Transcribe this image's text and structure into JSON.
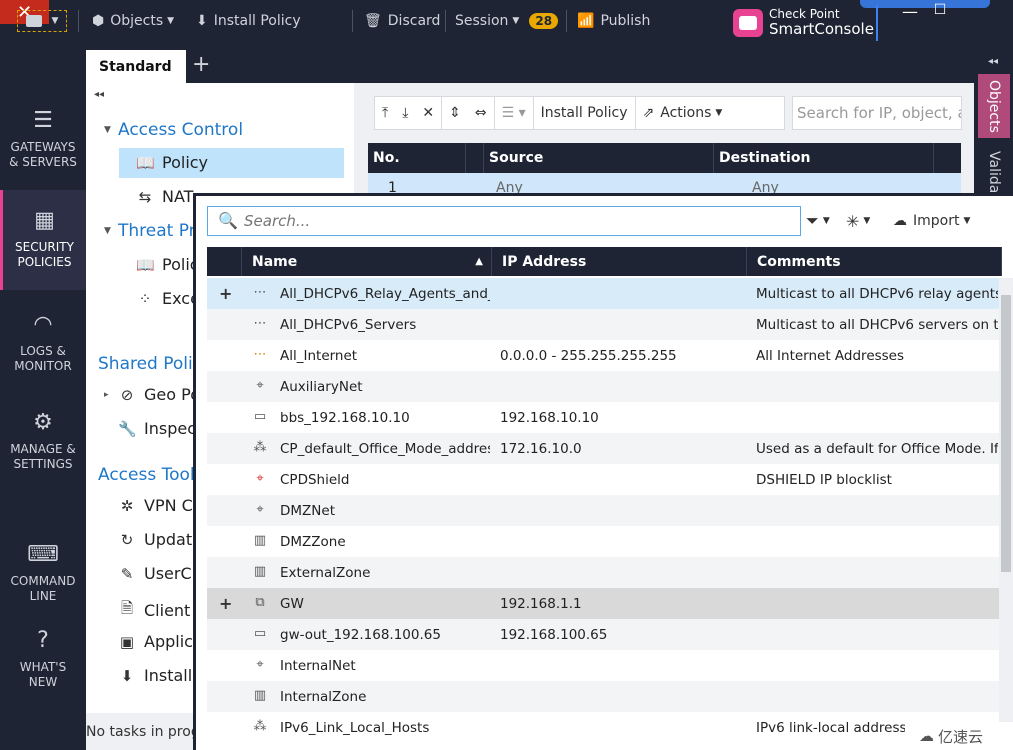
{
  "topbar": {
    "objects": "Objects",
    "install_policy": "Install Policy",
    "discard": "Discard",
    "session": "Session",
    "session_count": "28",
    "publish": "Publish",
    "brand_line1": "Check Point",
    "brand_line2": "SmartConsole"
  },
  "leftnav": [
    {
      "label1": "GATEWAYS",
      "label2": "& SERVERS"
    },
    {
      "label1": "SECURITY",
      "label2": "POLICIES"
    },
    {
      "label1": "LOGS &",
      "label2": "MONITOR"
    },
    {
      "label1": "MANAGE &",
      "label2": "SETTINGS"
    },
    {
      "label1": "COMMAND",
      "label2": "LINE"
    },
    {
      "label1": "WHAT'S",
      "label2": "NEW"
    }
  ],
  "tabs": {
    "standard": "Standard"
  },
  "tree": {
    "access_control": "Access Control",
    "policy": "Policy",
    "nat": "NAT",
    "threat_prevention": "Threat Pre",
    "threat_policy": "Polic",
    "exceptions": "Exce",
    "shared_policies": "Shared Polic",
    "geo_policy": "Geo Po",
    "inspection": "Inspec",
    "access_tools": "Access Tools",
    "vpn": "VPN Co",
    "updates": "Update",
    "userchk": "UserCh",
    "client": "Client C",
    "applic": "Applica",
    "install": "Installa"
  },
  "status": "No tasks in prog",
  "rulebase": {
    "install_policy": "Install Policy",
    "actions": "Actions",
    "search_placeholder": "Search for IP, object, ac",
    "columns": {
      "no": "No.",
      "source": "Source",
      "destination": "Destination"
    },
    "row1": {
      "no": "1",
      "source": "Any",
      "destination": "Any"
    }
  },
  "right": {
    "objects": "Objects",
    "validations": "Valida"
  },
  "explorer": {
    "search_placeholder": "Search...",
    "import": "Import",
    "columns": {
      "name": "Name",
      "ip": "IP Address",
      "comments": "Comments"
    },
    "rows": [
      {
        "icon": "multicast-icon",
        "name": "All_DHCPv6_Relay_Agents_and_...",
        "ip": "",
        "comment": "Multicast to all DHCPv6 relay agents...",
        "plus": true
      },
      {
        "icon": "multicast-icon",
        "name": "All_DHCPv6_Servers",
        "ip": "",
        "comment": "Multicast to all DHCPv6 servers on th...",
        "plus": false
      },
      {
        "icon": "address-range-icon",
        "name": "All_Internet",
        "ip": "0.0.0.0 - 255.255.255.255",
        "comment": "All Internet Addresses",
        "plus": false
      },
      {
        "icon": "network-icon",
        "name": "AuxiliaryNet",
        "ip": "",
        "comment": "",
        "plus": false
      },
      {
        "icon": "host-icon",
        "name": "bbs_192.168.10.10",
        "ip": "192.168.10.10",
        "comment": "",
        "plus": false
      },
      {
        "icon": "office-mode-icon",
        "name": "CP_default_Office_Mode_addres...",
        "ip": "172.16.10.0",
        "comment": "Used as a default for Office Mode. If...",
        "plus": false
      },
      {
        "icon": "blocklist-icon",
        "name": "CPDShield",
        "ip": "",
        "comment": "DSHIELD IP blocklist",
        "plus": false
      },
      {
        "icon": "network-icon",
        "name": "DMZNet",
        "ip": "",
        "comment": "",
        "plus": false
      },
      {
        "icon": "zone-icon",
        "name": "DMZZone",
        "ip": "",
        "comment": "",
        "plus": false
      },
      {
        "icon": "zone-icon",
        "name": "ExternalZone",
        "ip": "",
        "comment": "",
        "plus": false
      },
      {
        "icon": "gateway-icon",
        "name": "GW",
        "ip": "192.168.1.1",
        "comment": "",
        "plus": true
      },
      {
        "icon": "host-icon",
        "name": "gw-out_192.168.100.65",
        "ip": "192.168.100.65",
        "comment": "",
        "plus": false
      },
      {
        "icon": "network-icon",
        "name": "InternalNet",
        "ip": "",
        "comment": "",
        "plus": false
      },
      {
        "icon": "zone-icon",
        "name": "InternalZone",
        "ip": "",
        "comment": "",
        "plus": false
      },
      {
        "icon": "office-mode-icon",
        "name": "IPv6_Link_Local_Hosts",
        "ip": "",
        "comment": "IPv6 link-local addresses",
        "plus": false
      }
    ]
  },
  "watermark": "亿速云"
}
